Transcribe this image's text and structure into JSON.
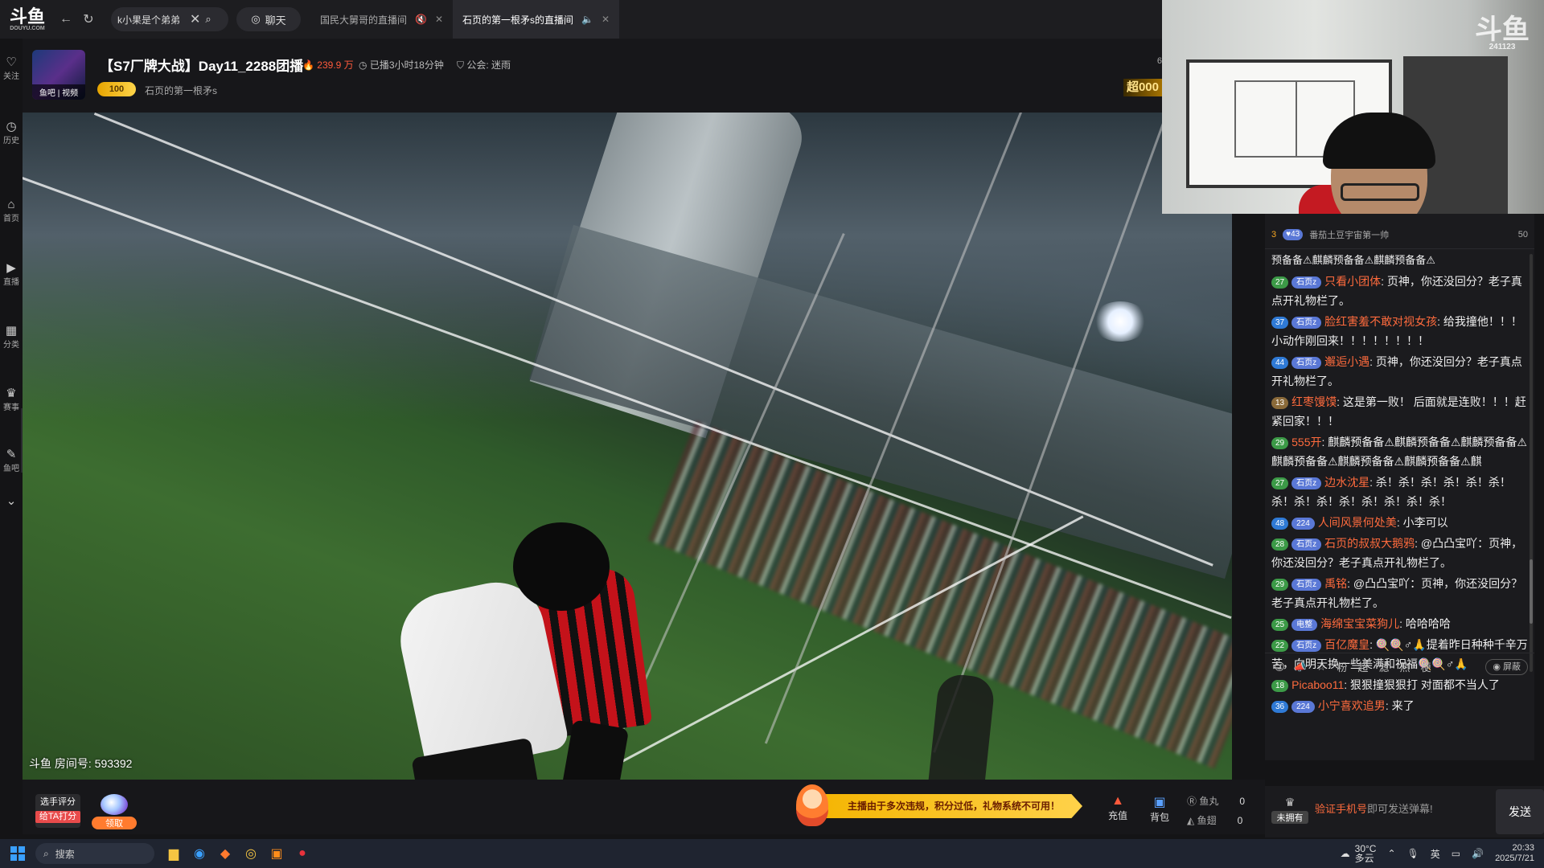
{
  "app": {
    "logo_text": "斗鱼",
    "logo_sub": "DOUYU.COM"
  },
  "topbar": {
    "search_value": "k小果是个弟弟",
    "chat_label": "聊天",
    "tabs": [
      {
        "label": "国民大舅哥的直播间",
        "active": false
      },
      {
        "label": "石页的第一根矛s的直播间",
        "active": true
      }
    ]
  },
  "sidebar": {
    "items": [
      {
        "icon": "heart-icon",
        "glyph": "♡",
        "label": "关注"
      },
      {
        "icon": "history-icon",
        "glyph": "◷",
        "label": "历史"
      },
      {
        "icon": "home-icon",
        "glyph": "⌂",
        "label": "首页"
      },
      {
        "icon": "live-icon",
        "glyph": "▶",
        "label": "直播"
      },
      {
        "icon": "category-icon",
        "glyph": "▦",
        "label": "分类"
      },
      {
        "icon": "trophy-icon",
        "glyph": "♛",
        "label": "赛事"
      },
      {
        "icon": "fishbar-icon",
        "glyph": "✎",
        "label": "鱼吧"
      },
      {
        "icon": "more-icon",
        "glyph": "⌄",
        "label": ""
      }
    ]
  },
  "room": {
    "avatar_tag": "鱼吧 | 视频",
    "title": "【S7厂牌大战】Day11_2288团播",
    "hot": "239.9 万",
    "live_time": "已播3小时18分钟",
    "guild": "公会: 迷雨",
    "level_badge": "100",
    "streamer_name": "石页的第一根矛s",
    "right_num": "6",
    "super_badge": "超000",
    "room_id": "斗鱼 房间号: 593392"
  },
  "webcam": {
    "watermark": "斗鱼",
    "watermark_sub": "241123"
  },
  "chat": {
    "top_rank": "3",
    "top_badge": "43",
    "top_name": "番茄土豆宇宙第一帅",
    "top_count": "50",
    "partial_line": "预备备⚠麒麟预备备⚠麒麟预备备⚠",
    "messages": [
      {
        "level": "27",
        "level_color": "#3c9a47",
        "fan": "石页z",
        "nick": "只看小团体",
        "text": "页神，你还没回分？老子真点开礼物栏了。"
      },
      {
        "level": "37",
        "level_color": "#2f7ad6",
        "fan": "石页z",
        "nick": "脸红害羞不敢对视女孩",
        "text": "给我撞他！！！小动作刚回来！！！！！！！！"
      },
      {
        "level": "44",
        "level_color": "#2f7ad6",
        "fan": "石页z",
        "nick": "邂逅小遇",
        "text": "页神，你还没回分？老子真点开礼物栏了。"
      },
      {
        "level": "13",
        "level_color": "#8a6a3a",
        "fan": "",
        "nick": "红枣馒馍",
        "text": "这是第一败！ 后面就是连败！！！赶紧回家！！！"
      },
      {
        "level": "29",
        "level_color": "#3c9a47",
        "fan": "",
        "nick": "555开",
        "text": "麒麟预备备⚠麒麟预备备⚠麒麟预备备⚠麒麟预备备⚠麒麟预备备⚠麒麟预备备⚠麒"
      },
      {
        "level": "27",
        "level_color": "#3c9a47",
        "fan": "石页z",
        "nick": "边水沈星",
        "text": "杀！杀！杀！杀！杀！杀！杀！杀！杀！杀！杀！杀！杀！杀！"
      },
      {
        "level": "48",
        "level_color": "#2f7ad6",
        "fan": "224",
        "nick": "人间风景何处美",
        "text": "小李可以"
      },
      {
        "level": "28",
        "level_color": "#3c9a47",
        "fan": "石页z",
        "nick": "石页的叔叔大鹅鸦",
        "text": "@凸凸宝吖：页神，你还没回分？老子真点开礼物栏了。"
      },
      {
        "level": "29",
        "level_color": "#3c9a47",
        "fan": "石页z",
        "nick": "禹铭",
        "text": "@凸凸宝吖：页神，你还没回分？老子真点开礼物栏了。"
      },
      {
        "level": "25",
        "level_color": "#3c9a47",
        "fan": "电整",
        "nick": "海绵宝宝菜狗儿",
        "text": "哈哈哈哈"
      },
      {
        "level": "22",
        "level_color": "#3c9a47",
        "fan": "石页z",
        "nick": "百亿魔皇",
        "text": "🍭🍭♂🙏提着昨日种种千辛万苦，向明天换一些美满和祝福🍭🍭♂🙏"
      },
      {
        "level": "18",
        "level_color": "#3c9a47",
        "fan": "",
        "nick": "Picaboo11",
        "text": "狠狠撞狠狠打 对面都不当人了"
      },
      {
        "level": "36",
        "level_color": "#2f7ad6",
        "fan": "224",
        "nick": "小宁喜欢追男",
        "text": "来了"
      }
    ],
    "tools": [
      "😊",
      "📣",
      "☆",
      "粉",
      "超",
      "滤",
      "热",
      "梗"
    ],
    "shield_label": "屏蔽"
  },
  "bottombar": {
    "rate_label": "选手评分",
    "rate_sub": "给TA打分",
    "claim_sub": "领取",
    "warning": "主播由于多次违规，积分过低，礼物系统不可用！",
    "recharge_label": "充值",
    "backpack_label": "背包",
    "fishball_label": "鱼丸",
    "fishball_value": "0",
    "fishwing_label": "鱼翅",
    "fishwing_value": "0"
  },
  "chat_input": {
    "nofan_label": "未拥有",
    "verify_link": "验证手机号",
    "verify_rest": "即可发送弹幕!",
    "send_label": "发送"
  },
  "taskbar": {
    "search_label": "搜索",
    "weather_temp": "30°C",
    "weather_desc": "多云",
    "ime": "英",
    "time": "20:33",
    "date": "2025/7/21"
  }
}
